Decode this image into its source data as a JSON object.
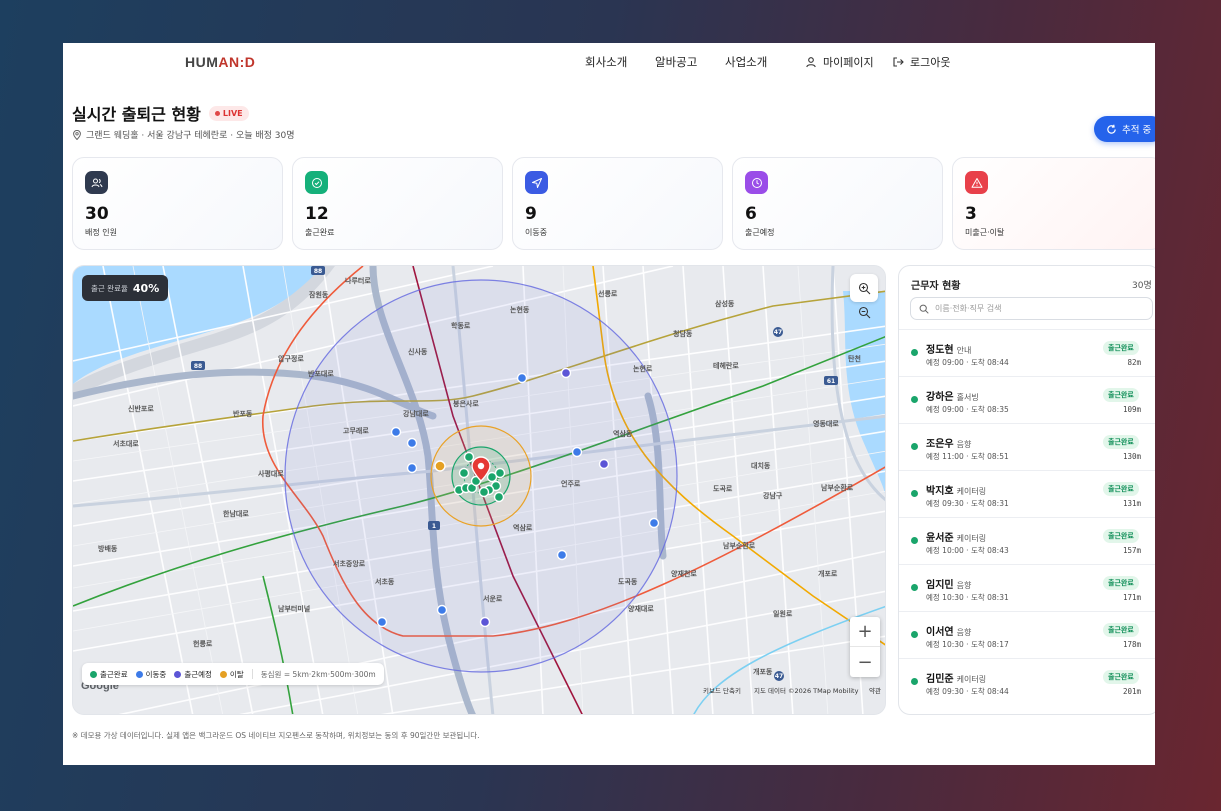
{
  "header": {
    "logo_left": "HUM",
    "logo_accent": "AN",
    "logo_right": ":D",
    "nav": [
      "회사소개",
      "알바공고",
      "사업소개"
    ],
    "mypage": "마이페이지",
    "logout": "로그아웃"
  },
  "page": {
    "title": "실시간 출퇴근 현황",
    "live": "LIVE",
    "subtitle": "그랜드 웨딩홀 · 서울 강남구 테헤란로 · 오늘 배정 30명",
    "track_button": "추적 중"
  },
  "stats": [
    {
      "value": "30",
      "label": "배정 인원",
      "icon": "users-icon",
      "color": "#2f3a4f"
    },
    {
      "value": "12",
      "label": "출근완료",
      "icon": "check-circle-icon",
      "color": "#15b07a"
    },
    {
      "value": "9",
      "label": "이동중",
      "icon": "navigation-icon",
      "color": "#3b5be3"
    },
    {
      "value": "6",
      "label": "출근예정",
      "icon": "clock-icon",
      "color": "#9a4de8"
    },
    {
      "value": "3",
      "label": "미출근·이탈",
      "icon": "alert-icon",
      "color": "#e8404a"
    }
  ],
  "map": {
    "rate_label": "출근 완료율",
    "rate_value": "40%",
    "progress_fraction": 0.4,
    "legend": [
      {
        "label": "출근완료",
        "color": "#1aa56b"
      },
      {
        "label": "이동중",
        "color": "#3d7be8"
      },
      {
        "label": "출근예정",
        "color": "#5c55d6"
      },
      {
        "label": "이탈",
        "color": "#e5a023"
      }
    ],
    "legend_note": "동심원 = 5km·2km·500m·300m",
    "google": "Google",
    "attrib_keyboard": "키보드 단축키",
    "attrib_data": "지도 데이터 ©2026 TMap Mobility",
    "attrib_terms": "약관",
    "labels": [
      "잠원동",
      "나루터로",
      "논현동",
      "학동로",
      "신사동",
      "압구정로",
      "청담동",
      "삼성동",
      "봉은사로",
      "선릉로",
      "강남대로",
      "서초대로",
      "고무래로",
      "서초동",
      "역삼동",
      "역삼로",
      "대치동",
      "도곡로",
      "도곡동",
      "양재천로",
      "개포로",
      "개포동",
      "남부순환로",
      "방배동",
      "반포대로",
      "반포동",
      "신반포로",
      "사평대로",
      "남부터미널",
      "서초중앙로",
      "서운로",
      "언주로",
      "테헤란로",
      "영동대로",
      "남부순환로",
      "헌릉로",
      "한남대로",
      "논현로",
      "양재대로",
      "강남구",
      "일원로",
      "탄천"
    ]
  },
  "workers": {
    "title": "근무자 현황",
    "count": "30명",
    "search_placeholder": "이름·전화·직무 검색",
    "list": [
      {
        "name": "정도현",
        "role": "안내",
        "time": "예정 09:00 · 도착 08:44",
        "status": "출근완료",
        "dist": "82m"
      },
      {
        "name": "강하은",
        "role": "홀서빙",
        "time": "예정 09:00 · 도착 08:35",
        "status": "출근완료",
        "dist": "109m"
      },
      {
        "name": "조은우",
        "role": "음향",
        "time": "예정 11:00 · 도착 08:51",
        "status": "출근완료",
        "dist": "130m"
      },
      {
        "name": "박지호",
        "role": "케이터링",
        "time": "예정 09:30 · 도착 08:31",
        "status": "출근완료",
        "dist": "131m"
      },
      {
        "name": "윤서준",
        "role": "케이터링",
        "time": "예정 10:00 · 도착 08:43",
        "status": "출근완료",
        "dist": "157m"
      },
      {
        "name": "임지민",
        "role": "음향",
        "time": "예정 10:30 · 도착 08:31",
        "status": "출근완료",
        "dist": "171m"
      },
      {
        "name": "이서연",
        "role": "음향",
        "time": "예정 10:30 · 도착 08:17",
        "status": "출근완료",
        "dist": "178m"
      },
      {
        "name": "김민준",
        "role": "케이터링",
        "time": "예정 09:30 · 도착 08:44",
        "status": "출근완료",
        "dist": "201m"
      }
    ]
  },
  "footnote": "※ 데모용 가상 데이터입니다. 실제 앱은 백그라운드 OS 네이티브 지오펜스로 동작하며, 위치정보는 동의 후 90일간만 보관됩니다."
}
